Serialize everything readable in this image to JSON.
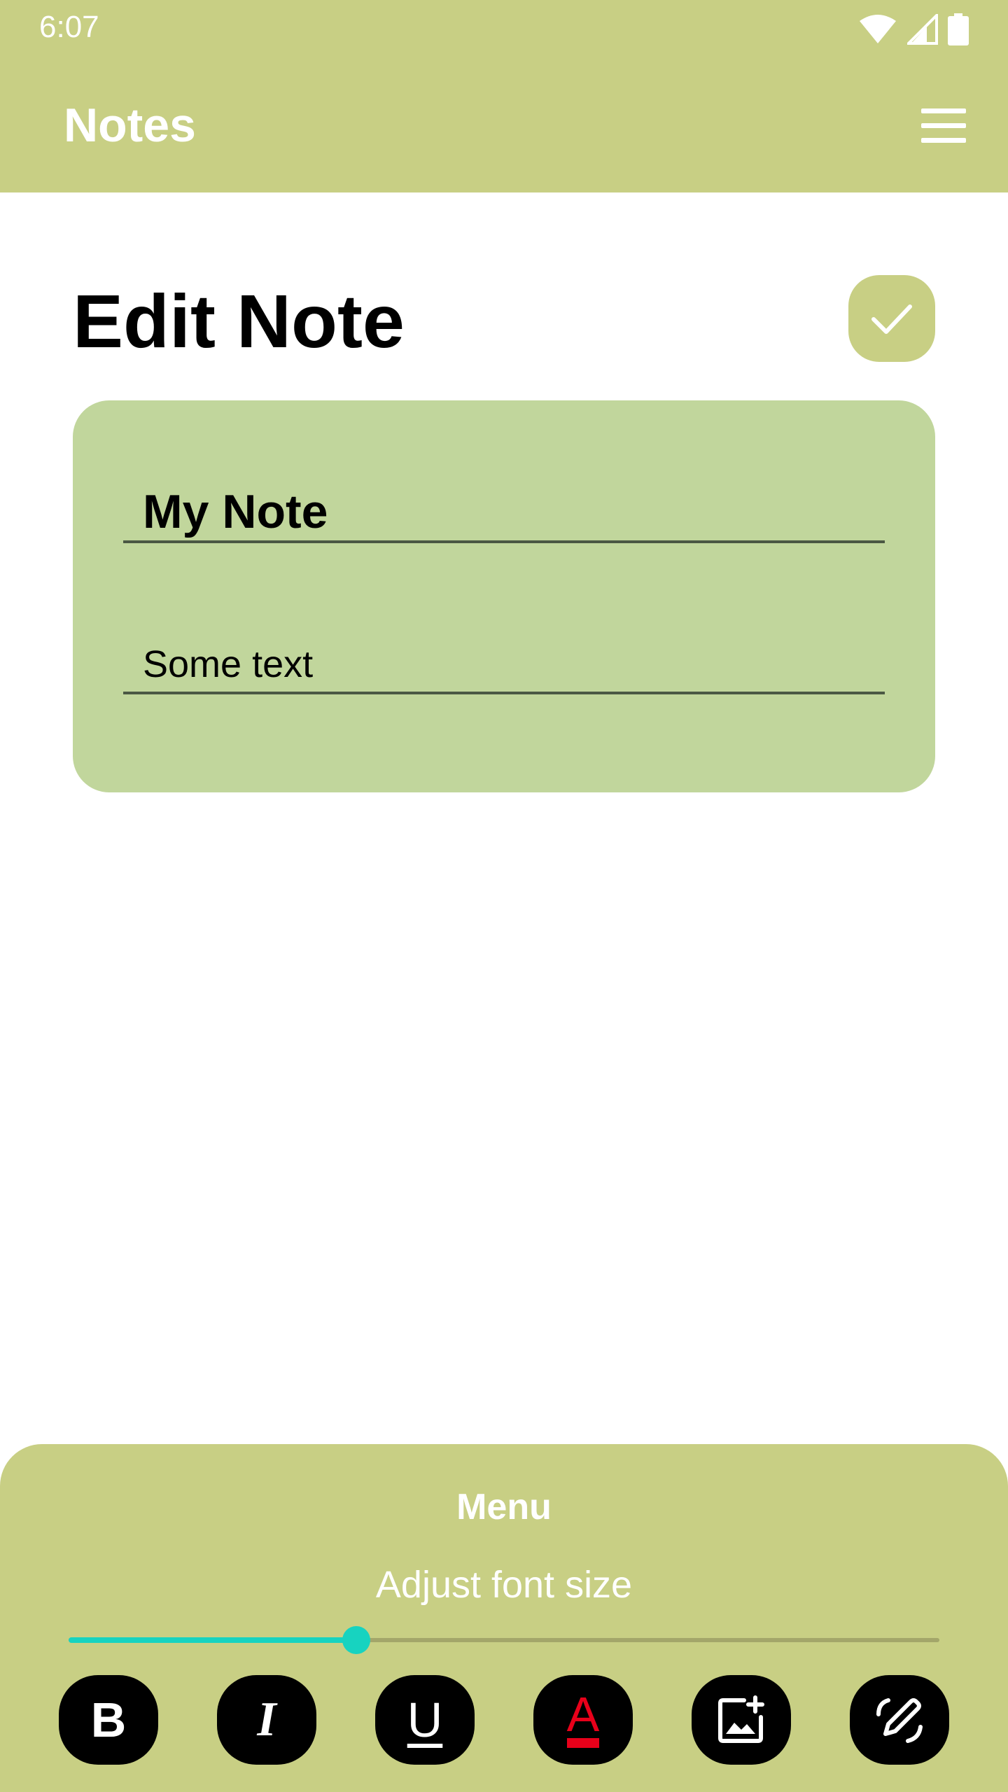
{
  "status_bar": {
    "time": "6:07"
  },
  "app_bar": {
    "title": "Notes"
  },
  "page": {
    "title": "Edit Note"
  },
  "note": {
    "title_value": "My Note",
    "body_value": "Some text"
  },
  "menu": {
    "title": "Menu",
    "font_size_label": "Adjust font size",
    "font_size_slider": {
      "value_fraction": 0.33
    },
    "tools": [
      {
        "name": "bold",
        "glyph": "B"
      },
      {
        "name": "italic",
        "glyph": "I"
      },
      {
        "name": "underline",
        "glyph": "U"
      },
      {
        "name": "text-color",
        "glyph": "A"
      },
      {
        "name": "add-image",
        "glyph": ""
      },
      {
        "name": "draw",
        "glyph": ""
      }
    ]
  },
  "colors": {
    "accent": "#c8cf84",
    "card": "#c1d69c",
    "slider": "#17d3c0",
    "text_color_indicator": "#e8001a"
  }
}
